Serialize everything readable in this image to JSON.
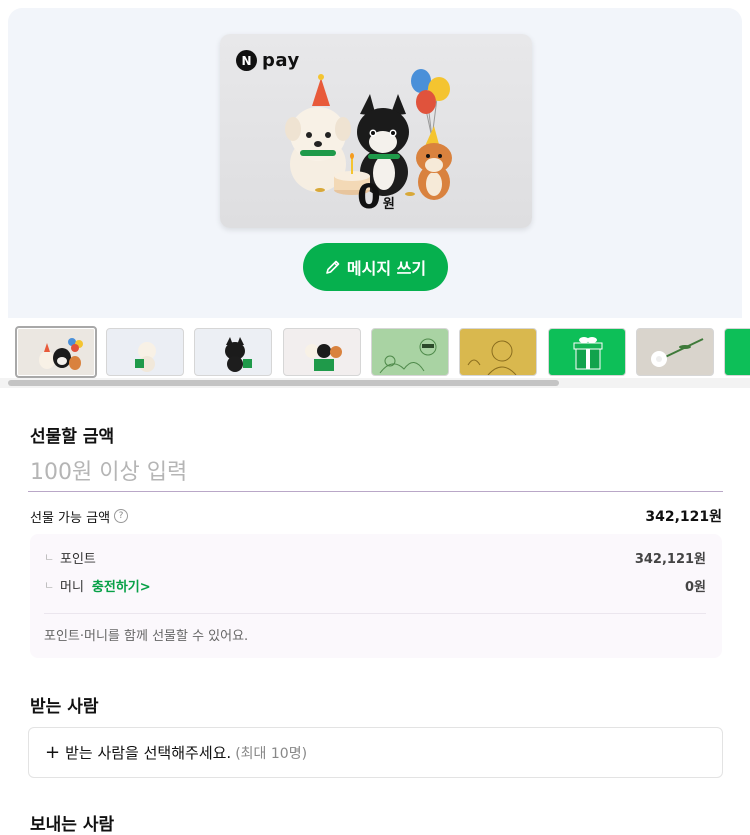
{
  "card": {
    "brand_badge": "N",
    "brand_text": "pay",
    "amount": "0",
    "amount_unit": "원"
  },
  "message_button": {
    "label": "메시지 쓰기",
    "icon": "pencil-icon"
  },
  "thumbnails": [
    {
      "name": "thumb-party-dogs",
      "selected": true
    },
    {
      "name": "thumb-white-dog-gift",
      "selected": false
    },
    {
      "name": "thumb-black-cat-gift",
      "selected": false
    },
    {
      "name": "thumb-trio-gift",
      "selected": false
    },
    {
      "name": "thumb-green-sketch",
      "selected": false
    },
    {
      "name": "thumb-gold-portrait",
      "selected": false
    },
    {
      "name": "thumb-green-giftbox",
      "selected": false
    },
    {
      "name": "thumb-white-flower",
      "selected": false
    },
    {
      "name": "thumb-green-partial",
      "selected": false
    }
  ],
  "gift_amount": {
    "title": "선물할 금액",
    "placeholder": "100원 이상 입력",
    "available_label": "선물 가능 금액",
    "help_icon": "?",
    "available_value": "342,121원"
  },
  "details": {
    "branch_symbol": "ㄴ",
    "point_label": "포인트",
    "point_value": "342,121원",
    "money_label": "머니",
    "charge_link": "충전하기>",
    "money_value": "0원",
    "note": "포인트·머니를 함께 선물할 수 있어요."
  },
  "recipient": {
    "title": "받는 사람",
    "plus": "+",
    "prompt": "받는 사람을 선택해주세요.",
    "limit": "(최대 10명)"
  },
  "sender": {
    "title": "보내는 사람"
  },
  "colors": {
    "accent": "#06b04e",
    "link": "#06a046"
  }
}
